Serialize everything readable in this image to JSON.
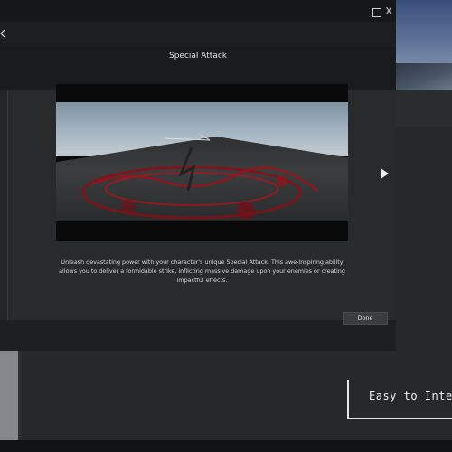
{
  "window": {
    "maximize_icon": "square-icon",
    "close_label": "X"
  },
  "dialog": {
    "title": "Special Attack",
    "prev_icon": "chevron-left-icon",
    "next_icon": "play-arrow-icon",
    "description": "Unleash devastating power with your character's unique Special Attack. This awe-inspiring ability allows you to deliver a formidable strike, inflicting massive damage upon your enemies or creating impactful effects.",
    "done_label": "Done"
  },
  "background": {
    "caption": "Easy to Integr"
  },
  "colors": {
    "dialog_bg": "#242526",
    "header_bg": "#1a1b1c",
    "accent_red": "#b3121c"
  }
}
